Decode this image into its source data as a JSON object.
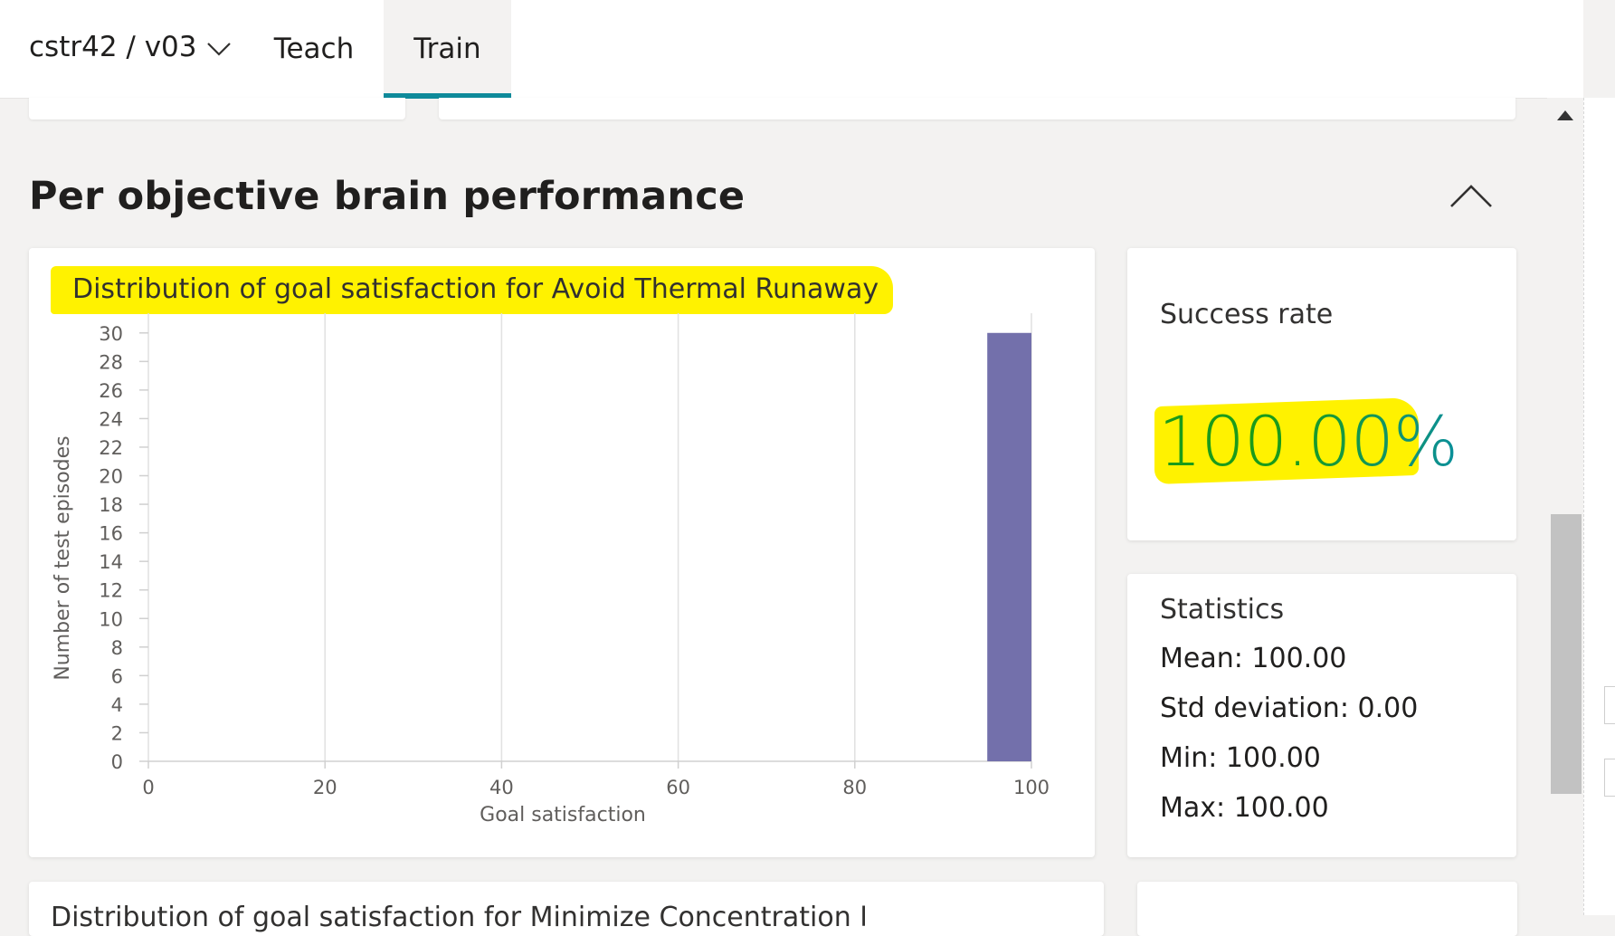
{
  "nav": {
    "project": "cstr42 / v03",
    "tabs": [
      {
        "label": "Teach"
      },
      {
        "label": "Train",
        "active": true
      }
    ]
  },
  "section": {
    "title": "Per objective brain performance"
  },
  "chart_card": {
    "title": "Distribution of goal satisfaction for Avoid Thermal Runaway"
  },
  "chart_data": {
    "type": "bar",
    "title": "Distribution of goal satisfaction for Avoid Thermal Runaway",
    "xlabel": "Goal satisfaction",
    "ylabel": "Number of test episodes",
    "xlim": [
      0,
      100
    ],
    "ylim": [
      0,
      31
    ],
    "x_ticks": [
      0,
      20,
      40,
      60,
      80,
      100
    ],
    "y_ticks": [
      0,
      2,
      4,
      6,
      8,
      10,
      12,
      14,
      16,
      18,
      20,
      22,
      24,
      26,
      28,
      30
    ],
    "bins": [
      {
        "x0": 95,
        "x1": 100,
        "value": 30
      }
    ],
    "bar_color": "#7370ab",
    "grid": "vertical"
  },
  "success": {
    "title": "Success rate",
    "value": "100.00%",
    "value_color_start": "#1a9b1a",
    "value_color_end": "#0a8f9c"
  },
  "stats": {
    "title": "Statistics",
    "mean_label": "Mean:",
    "mean": "100.00",
    "std_label": "Std deviation:",
    "std": "0.00",
    "min_label": "Min:",
    "min": "100.00",
    "max_label": "Max:",
    "max": "100.00"
  },
  "next_card": {
    "title": "Distribution of goal satisfaction for Minimize Concentration Ref..."
  },
  "icons": {
    "project_dropdown": "chevron-down-icon",
    "collapse": "chevron-up-icon",
    "scroll_up": "triangle-up-icon"
  }
}
